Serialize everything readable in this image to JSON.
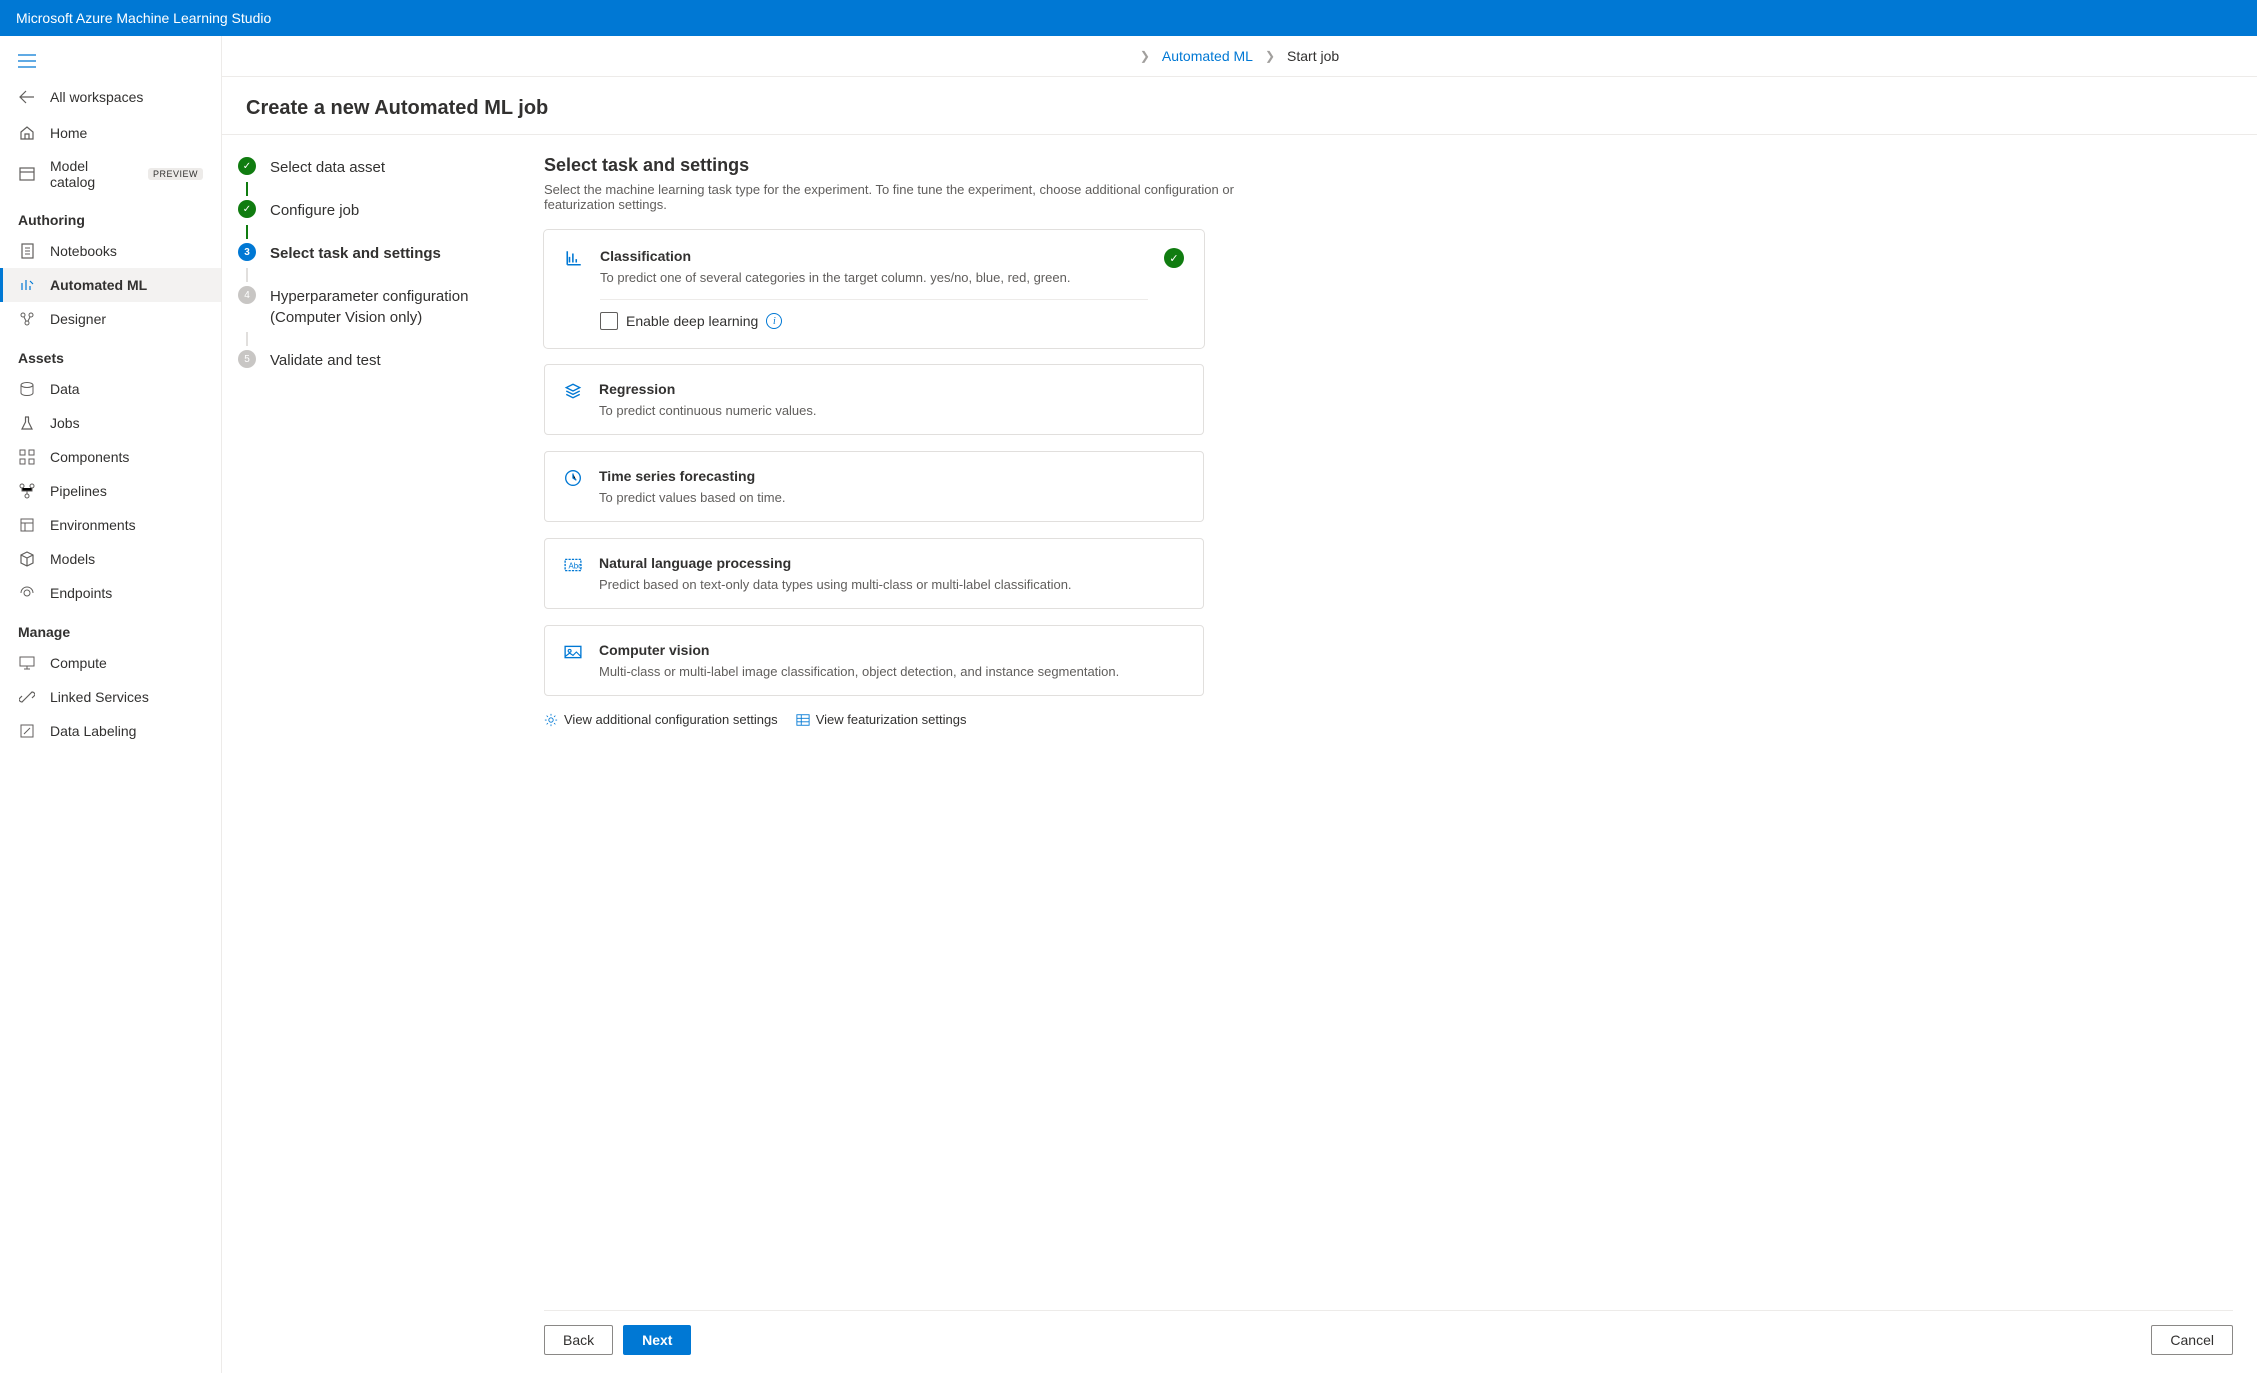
{
  "topbar": {
    "title": "Microsoft Azure Machine Learning Studio"
  },
  "sidebar": {
    "all_workspaces": "All workspaces",
    "items_top": [
      {
        "label": "Home"
      },
      {
        "label": "Model catalog",
        "preview": "PREVIEW"
      }
    ],
    "section_authoring": "Authoring",
    "items_authoring": [
      {
        "label": "Notebooks"
      },
      {
        "label": "Automated ML",
        "active": true
      },
      {
        "label": "Designer"
      }
    ],
    "section_assets": "Assets",
    "items_assets": [
      {
        "label": "Data"
      },
      {
        "label": "Jobs"
      },
      {
        "label": "Components"
      },
      {
        "label": "Pipelines"
      },
      {
        "label": "Environments"
      },
      {
        "label": "Models"
      },
      {
        "label": "Endpoints"
      }
    ],
    "section_manage": "Manage",
    "items_manage": [
      {
        "label": "Compute"
      },
      {
        "label": "Linked Services"
      },
      {
        "label": "Data Labeling"
      }
    ]
  },
  "breadcrumb": {
    "linked": "Automated ML",
    "current": "Start job"
  },
  "page": {
    "title": "Create a new Automated ML job"
  },
  "steps": [
    {
      "label": "Select data asset",
      "state": "done"
    },
    {
      "label": "Configure job",
      "state": "done"
    },
    {
      "label": "Select task and settings",
      "state": "current",
      "number": "3"
    },
    {
      "label": "Hyperparameter configuration (Computer Vision only)",
      "state": "pending",
      "number": "4"
    },
    {
      "label": "Validate and test",
      "state": "pending",
      "number": "5"
    }
  ],
  "content": {
    "heading": "Select task and settings",
    "subtitle": "Select the machine learning task type for the experiment. To fine tune the experiment, choose additional configuration or featurization settings.",
    "tasks": [
      {
        "title": "Classification",
        "desc": "To predict one of several categories in the target column. yes/no, blue, red, green.",
        "selected": true,
        "enable_dl_label": "Enable deep learning"
      },
      {
        "title": "Regression",
        "desc": "To predict continuous numeric values."
      },
      {
        "title": "Time series forecasting",
        "desc": "To predict values based on time."
      },
      {
        "title": "Natural language processing",
        "desc": "Predict based on text-only data types using multi-class or multi-label classification."
      },
      {
        "title": "Computer vision",
        "desc": "Multi-class or multi-label image classification, object detection, and instance segmentation."
      }
    ],
    "link_config": "View additional configuration settings",
    "link_feat": "View featurization settings"
  },
  "footer": {
    "back": "Back",
    "next": "Next",
    "cancel": "Cancel"
  }
}
